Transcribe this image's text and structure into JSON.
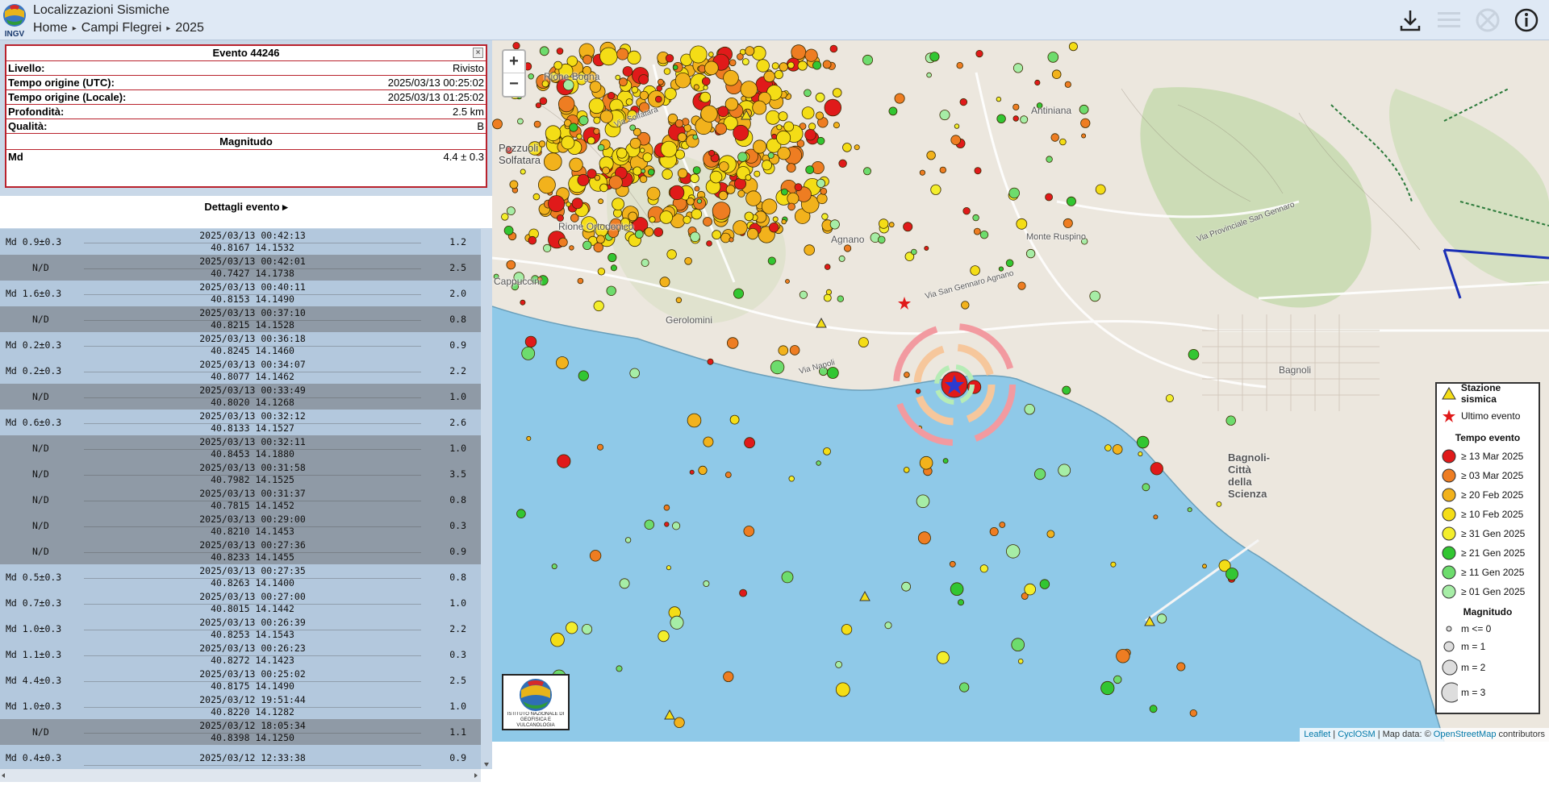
{
  "header": {
    "app_title": "Localizzazioni Sismiche",
    "breadcrumb": [
      "Home",
      "Campi Flegrei",
      "2025"
    ],
    "logo_text": "INGV"
  },
  "event": {
    "title": "Evento 44246",
    "rows": [
      {
        "key": "Livello:",
        "value": "Rivisto"
      },
      {
        "key": "Tempo origine (UTC):",
        "value": "2025/03/13 00:25:02"
      },
      {
        "key": "Tempo origine (Locale):",
        "value": "2025/03/13 01:25:02"
      },
      {
        "key": "Profondità:",
        "value": "2.5 km"
      },
      {
        "key": "Qualità:",
        "value": "B"
      }
    ],
    "magnitude_heading": "Magnitudo",
    "magnitude_type": "Md",
    "magnitude_value": "4.4 ± 0.3",
    "details_label": "Dettagli evento ▸"
  },
  "list": [
    {
      "mag": "Md 0.9±0.3",
      "time": "2025/03/13 00:42:13",
      "coords": "40.8167 14.1532",
      "depth": "1.2"
    },
    {
      "mag": "N/D",
      "time": "2025/03/13 00:42:01",
      "coords": "40.7427 14.1738",
      "depth": "2.5"
    },
    {
      "mag": "Md 1.6±0.3",
      "time": "2025/03/13 00:40:11",
      "coords": "40.8153 14.1490",
      "depth": "2.0"
    },
    {
      "mag": "N/D",
      "time": "2025/03/13 00:37:10",
      "coords": "40.8215 14.1528",
      "depth": "0.8"
    },
    {
      "mag": "Md 0.2±0.3",
      "time": "2025/03/13 00:36:18",
      "coords": "40.8245 14.1460",
      "depth": "0.9"
    },
    {
      "mag": "Md 0.2±0.3",
      "time": "2025/03/13 00:34:07",
      "coords": "40.8077 14.1462",
      "depth": "2.2"
    },
    {
      "mag": "N/D",
      "time": "2025/03/13 00:33:49",
      "coords": "40.8020 14.1268",
      "depth": "1.0"
    },
    {
      "mag": "Md 0.6±0.3",
      "time": "2025/03/13 00:32:12",
      "coords": "40.8133 14.1527",
      "depth": "2.6"
    },
    {
      "mag": "N/D",
      "time": "2025/03/13 00:32:11",
      "coords": "40.8453 14.1880",
      "depth": "1.0"
    },
    {
      "mag": "N/D",
      "time": "2025/03/13 00:31:58",
      "coords": "40.7982 14.1525",
      "depth": "3.5"
    },
    {
      "mag": "N/D",
      "time": "2025/03/13 00:31:37",
      "coords": "40.7815 14.1452",
      "depth": "0.8"
    },
    {
      "mag": "N/D",
      "time": "2025/03/13 00:29:00",
      "coords": "40.8210 14.1453",
      "depth": "0.3"
    },
    {
      "mag": "N/D",
      "time": "2025/03/13 00:27:36",
      "coords": "40.8233 14.1455",
      "depth": "0.9"
    },
    {
      "mag": "Md 0.5±0.3",
      "time": "2025/03/13 00:27:35",
      "coords": "40.8263 14.1400",
      "depth": "0.8"
    },
    {
      "mag": "Md 0.7±0.3",
      "time": "2025/03/13 00:27:00",
      "coords": "40.8015 14.1442",
      "depth": "1.0"
    },
    {
      "mag": "Md 1.0±0.3",
      "time": "2025/03/13 00:26:39",
      "coords": "40.8253 14.1543",
      "depth": "2.2"
    },
    {
      "mag": "Md 1.1±0.3",
      "time": "2025/03/13 00:26:23",
      "coords": "40.8272 14.1423",
      "depth": "0.3"
    },
    {
      "mag": "Md 4.4±0.3",
      "time": "2025/03/13 00:25:02",
      "coords": "40.8175 14.1490",
      "depth": "2.5"
    },
    {
      "mag": "Md 1.0±0.3",
      "time": "2025/03/12 19:51:44",
      "coords": "40.8220 14.1282",
      "depth": "1.0"
    },
    {
      "mag": "N/D",
      "time": "2025/03/12 18:05:34",
      "coords": "40.8398 14.1250",
      "depth": "1.1"
    },
    {
      "mag": "Md 0.4±0.3",
      "time": "2025/03/12 12:33:38",
      "coords": "",
      "depth": "0.9"
    }
  ],
  "map": {
    "zoom_in": "+",
    "zoom_out": "−",
    "labels": [
      "Pozzuoli",
      "Solfatara",
      "Rione Ortodonico",
      "Cappuccini",
      "Gerolomini",
      "Agnano",
      "Bagnoli",
      "Bagnoli-Città della Scienza",
      "Via Solfatara",
      "Via Napoli",
      "Via San Gennaro Agnano",
      "Via Provinciale San Gennaro",
      "Rione Bogna",
      "Antiniana",
      "Monte Ruspino"
    ],
    "logo_caption": "ISTITUTO NAZIONALE DI GEOFISICA E VULCANOLOGIA",
    "attribution": {
      "leaflet": "Leaflet",
      "cyclosm": "CyclOSM",
      "map_data": "Map data: ©",
      "osm": "OpenStreetMap",
      "contributors": "contributors"
    },
    "sea_color": "#8fc9e8",
    "land_color": "#ece7de"
  },
  "legend": {
    "station": "Stazione sismica",
    "last_event": "Ultimo evento",
    "time_heading": "Tempo evento",
    "time_items": [
      {
        "label": "≥ 13 Mar 2025",
        "color": "#e01a1a"
      },
      {
        "label": "≥ 03 Mar 2025",
        "color": "#ee7d22"
      },
      {
        "label": "≥ 20 Feb 2025",
        "color": "#f2b21c"
      },
      {
        "label": "≥ 10 Feb 2025",
        "color": "#f4dd16"
      },
      {
        "label": "≥ 31 Gen 2025",
        "color": "#f3ee2c"
      },
      {
        "label": "≥ 21 Gen 2025",
        "color": "#32c632"
      },
      {
        "label": "≥ 11 Gen 2025",
        "color": "#6ddc6d"
      },
      {
        "label": "≥ 01 Gen 2025",
        "color": "#a6eda6"
      }
    ],
    "mag_heading": "Magnitudo",
    "mag_items": [
      "m <= 0",
      "m = 1",
      "m = 2",
      "m = 3"
    ]
  }
}
